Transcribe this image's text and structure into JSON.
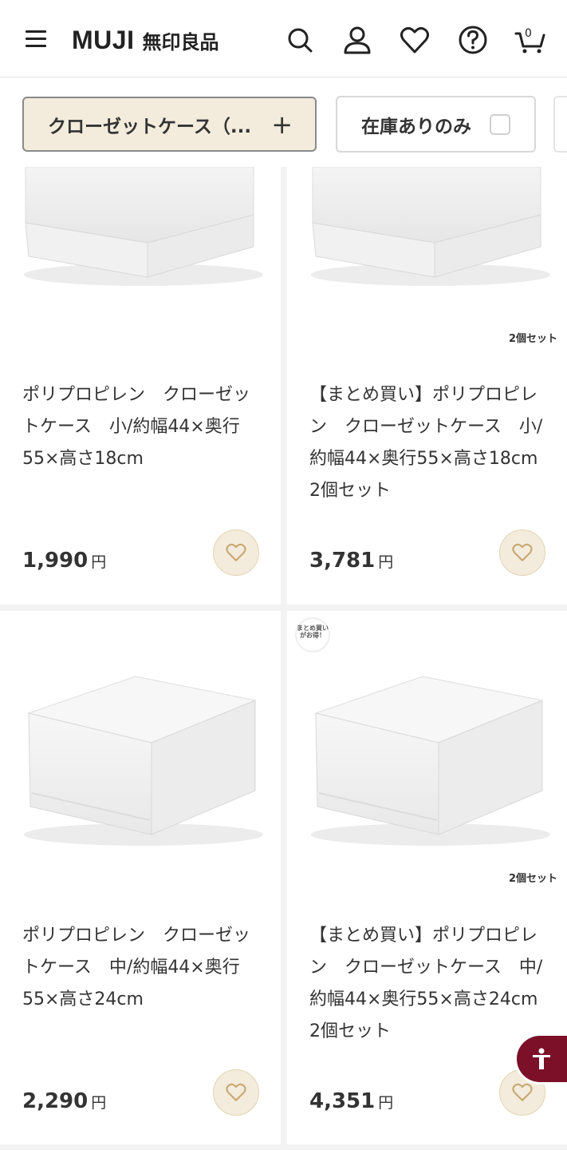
{
  "header": {
    "logo_latin": "MUJI",
    "logo_kanji": "無印良品",
    "cart_count": "0",
    "icons": [
      "menu-icon",
      "search-icon",
      "account-icon",
      "heart-icon",
      "help-icon",
      "cart-icon"
    ]
  },
  "filters": {
    "category_chip": "クローゼットケース（...",
    "category_plus": "+",
    "stock_chip": "在庫ありのみ"
  },
  "products": [
    {
      "title": "ポリプロピレン　クローゼットケース　小/約幅44×奥行55×高さ18cm",
      "price": "1,990",
      "currency": "円",
      "set_label": "",
      "badge": ""
    },
    {
      "title": "【まとめ買い】ポリプロピレン　クローゼットケース　小/約幅44×奥行55×高さ18cm 2個セット",
      "price": "3,781",
      "currency": "円",
      "set_label": "2個セット",
      "badge": ""
    },
    {
      "title": "ポリプロピレン　クローゼットケース　中/約幅44×奥行55×高さ24cm",
      "price": "2,290",
      "currency": "円",
      "set_label": "",
      "badge": ""
    },
    {
      "title": "【まとめ買い】ポリプロピレン　クローゼットケース　中/約幅44×奥行55×高さ24cm 2個セット",
      "price": "4,351",
      "currency": "円",
      "set_label": "2個セット",
      "badge": "まとめ買いがお得！"
    }
  ],
  "colors": {
    "chip_bg": "#f3ecdd",
    "accessibility_button": "#7b1028",
    "fav_stroke": "#c8a770"
  }
}
